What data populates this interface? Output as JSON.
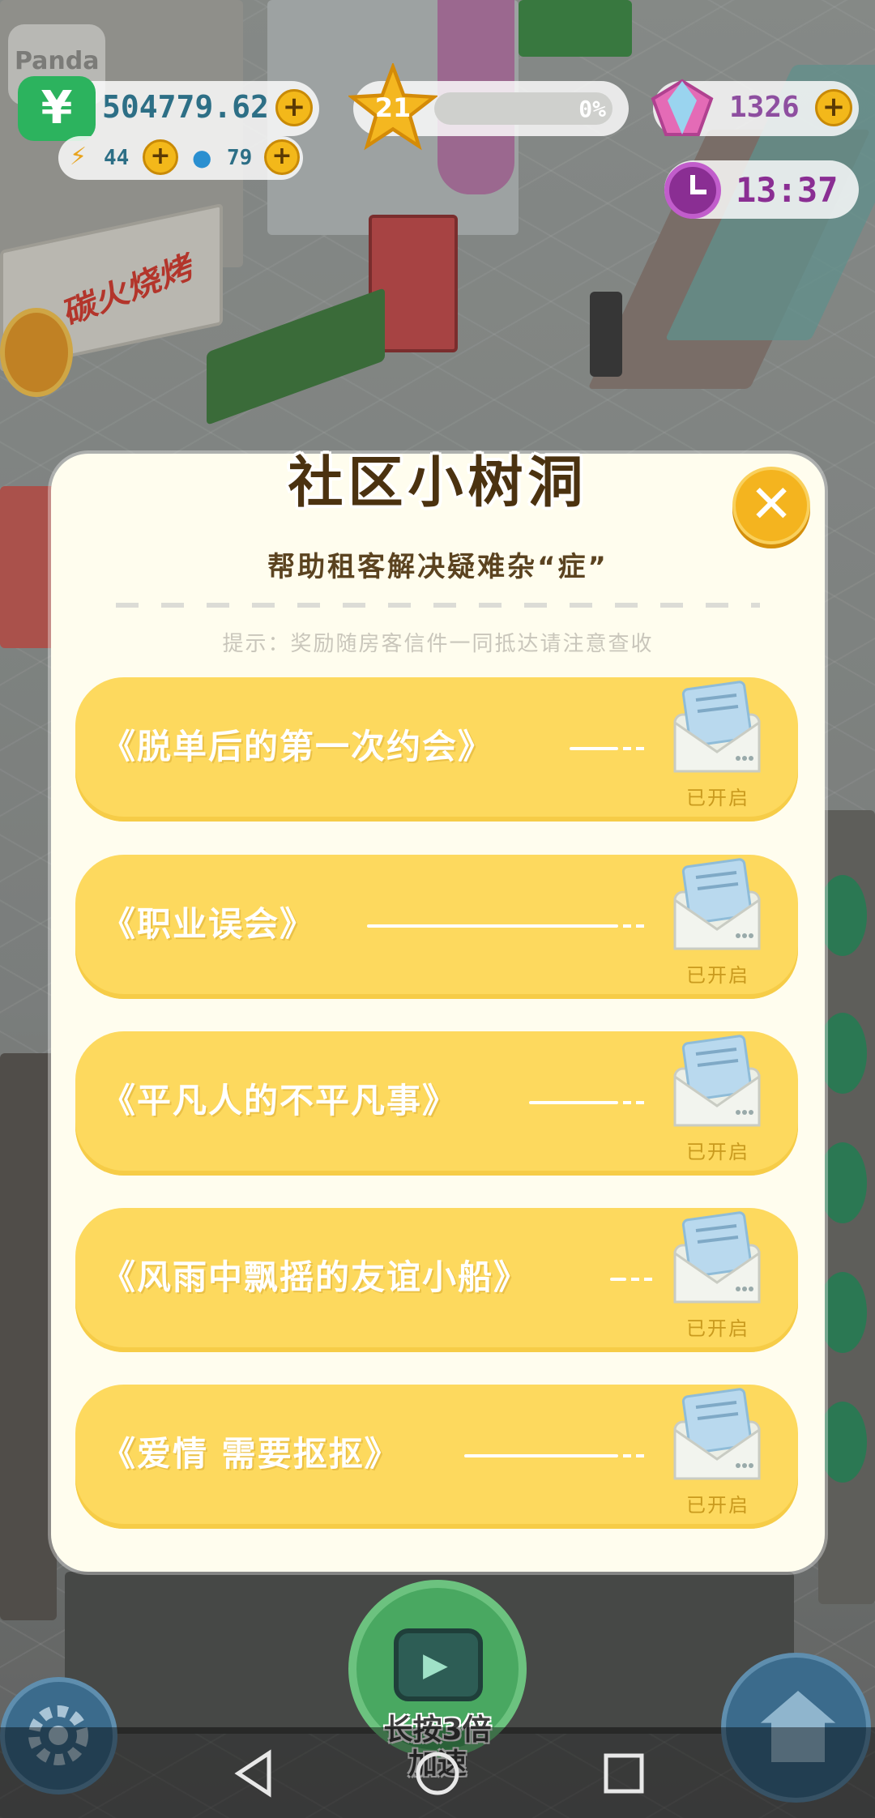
{
  "hud": {
    "money": "504779.62",
    "energy": "44",
    "water": "79",
    "level": "21",
    "xp_percent": "0%",
    "gems": "1326",
    "clock": "13:37",
    "shop_sign": "碳火烧烤",
    "brand_sign": "Panda"
  },
  "modal": {
    "title": "社区小树洞",
    "subtitle": "帮助租客解决疑难杂“症”",
    "hint": "提示：奖励随房客信件一同抵达请注意查收",
    "letters": [
      {
        "title": "《脱单后的第一次约会》",
        "status": "已开启"
      },
      {
        "title": "《职业误会》",
        "status": "已开启"
      },
      {
        "title": "《平凡人的不平凡事》",
        "status": "已开启"
      },
      {
        "title": "《风雨中飘摇的友谊小船》",
        "status": "已开启"
      },
      {
        "title": "《爱情 需要抠抠》",
        "status": "已开启"
      }
    ]
  },
  "bottom": {
    "speed_label_1": "长按3倍",
    "speed_label_2": "加速"
  },
  "colors": {
    "modal_bg": "#fffdee",
    "letter_bg": "#fdd95e",
    "close_btn": "#f4b41f",
    "plus_btn": "#f3b81a",
    "hud_text": "#2d6f86"
  }
}
